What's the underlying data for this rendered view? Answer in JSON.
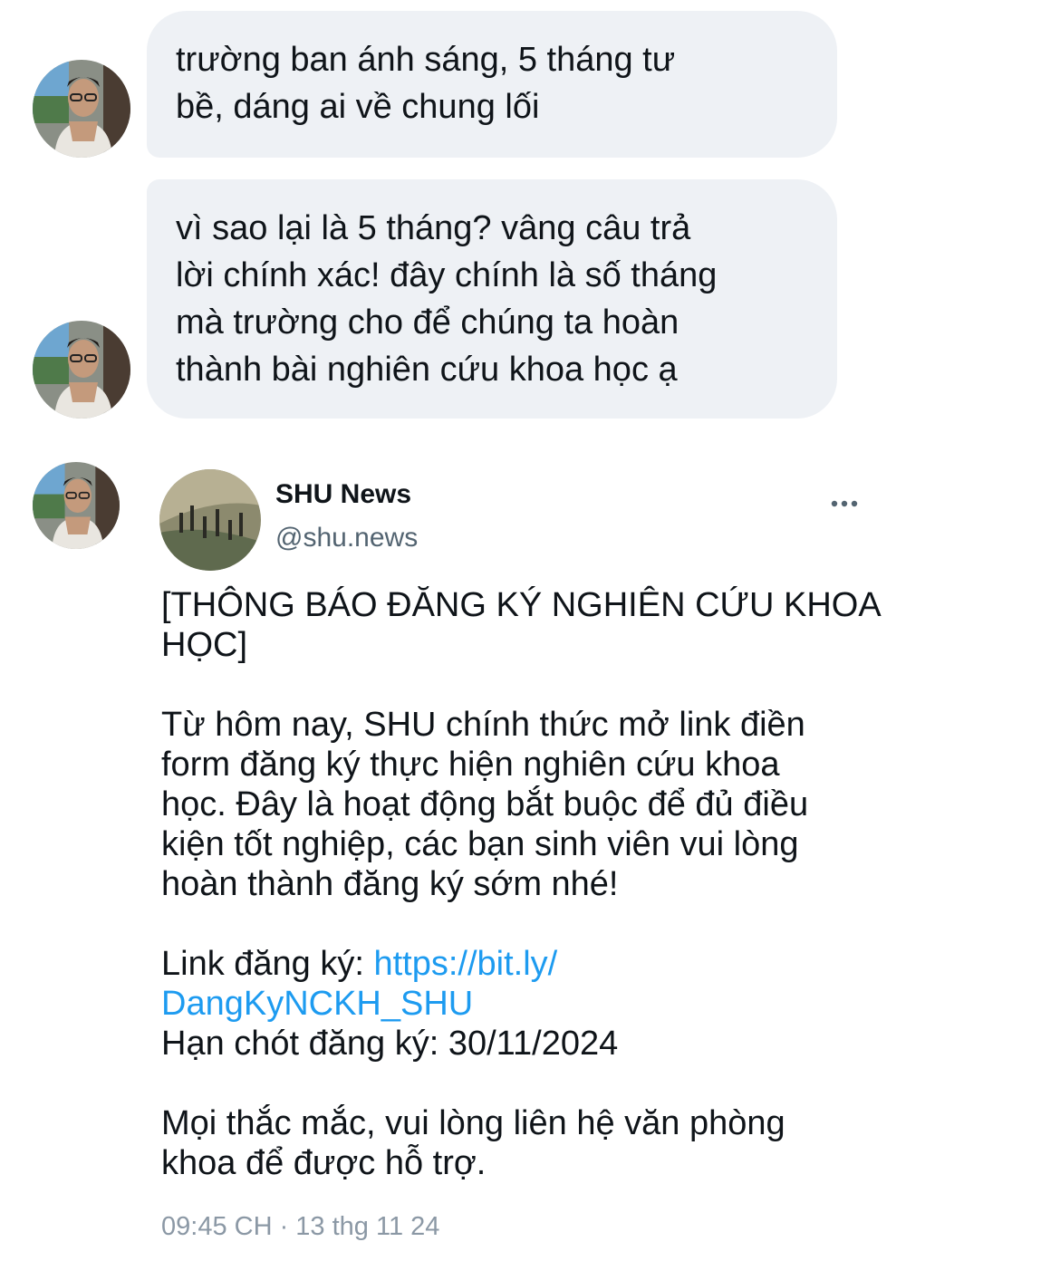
{
  "messages": [
    {
      "text": "trường ban ánh sáng, 5 tháng tư\nbề, dáng ai về chung lối"
    },
    {
      "text": "vì sao lại là 5 tháng? vâng câu trả\nlời chính xác! đây chính là số tháng\nmà trường cho để chúng ta hoàn\nthành bài nghiên cứu khoa học ạ"
    }
  ],
  "shared_post": {
    "author_name": "SHU News",
    "author_handle": "@shu.news",
    "more_icon": "more-horizontal-icon",
    "title": "[THÔNG BÁO ĐĂNG KÝ NGHIÊN CỨU KHOA\nHỌC]",
    "paragraph_1": "Từ hôm nay, SHU chính thức mở link điền\nform đăng ký thực hiện nghiên cứu khoa\nhọc. Đây là hoạt động bắt buộc để đủ điều\nkiện tốt nghiệp, các bạn sinh viên vui lòng\nhoàn thành đăng ký sớm nhé!",
    "link_label": "Link đăng ký: ",
    "link_url": "https://bit.ly/\nDangKyNCKH_SHU",
    "deadline": "Hạn chót đăng ký: 30/11/2024",
    "closing": "Mọi thắc mắc, vui lòng liên hệ văn phòng\nkhoa để được hỗ trợ.",
    "timestamp": "09:45 CH · 13 thg 11 24"
  },
  "colors": {
    "bubble_bg": "#eef1f5",
    "link": "#1d9bf0",
    "secondary_text": "#536471",
    "timestamp": "#8b98a5"
  }
}
